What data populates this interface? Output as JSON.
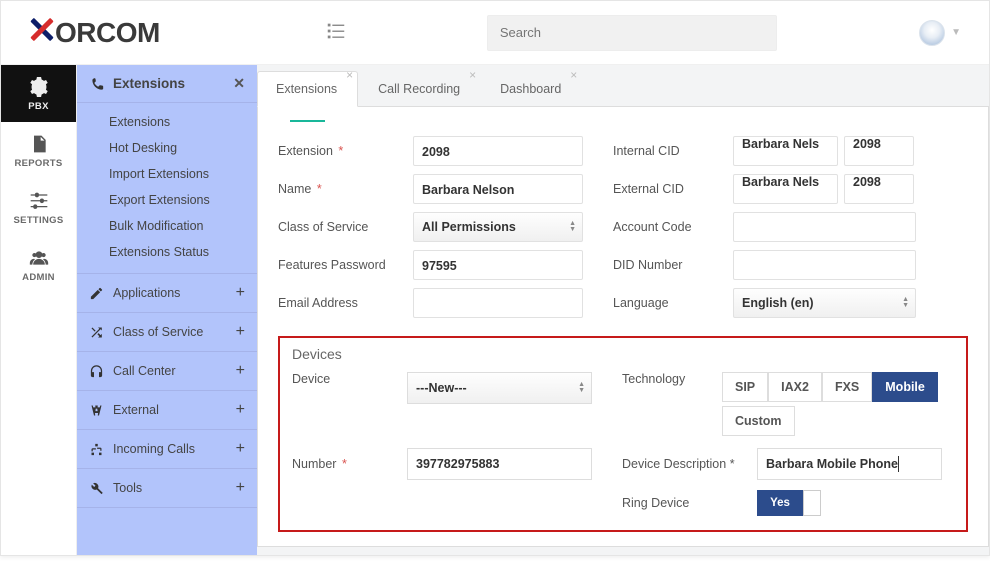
{
  "topbar": {
    "logo_text": "ORCOM",
    "search_placeholder": "Search"
  },
  "primary_nav": {
    "pbx": "PBX",
    "reports": "REPORTS",
    "settings": "SETTINGS",
    "admin": "ADMIN"
  },
  "secondary_nav": {
    "header": "Extensions",
    "sub_items": [
      "Extensions",
      "Hot Desking",
      "Import Extensions",
      "Export Extensions",
      "Bulk Modification",
      "Extensions Status"
    ],
    "groups": [
      "Applications",
      "Class of Service",
      "Call Center",
      "External",
      "Incoming Calls",
      "Tools"
    ]
  },
  "tabs": {
    "t1": "Extensions",
    "t2": "Call Recording",
    "t3": "Dashboard"
  },
  "form": {
    "extension_label": "Extension",
    "extension_value": "2098",
    "internal_cid_label": "Internal CID",
    "internal_cid_name": "Barbara Nels",
    "internal_cid_num": "2098",
    "name_label": "Name",
    "name_value": "Barbara Nelson",
    "external_cid_label": "External CID",
    "external_cid_name": "Barbara Nels",
    "external_cid_num": "2098",
    "cos_label": "Class of Service",
    "cos_value": "All Permissions",
    "account_code_label": "Account Code",
    "features_pw_label": "Features Password",
    "features_pw_value": "97595",
    "did_label": "DID Number",
    "email_label": "Email Address",
    "language_label": "Language",
    "language_value": "English (en)"
  },
  "devices": {
    "section_title": "Devices",
    "device_label": "Device",
    "device_select": "---New---",
    "technology_label": "Technology",
    "tech_options": {
      "sip": "SIP",
      "iax2": "IAX2",
      "fxs": "FXS",
      "mobile": "Mobile",
      "custom": "Custom"
    },
    "number_label": "Number",
    "number_value": "397782975883",
    "description_label": "Device Description",
    "description_value": "Barbara Mobile Phone",
    "ring_device_label": "Ring Device",
    "ring_device_value": "Yes",
    "required": "*"
  }
}
